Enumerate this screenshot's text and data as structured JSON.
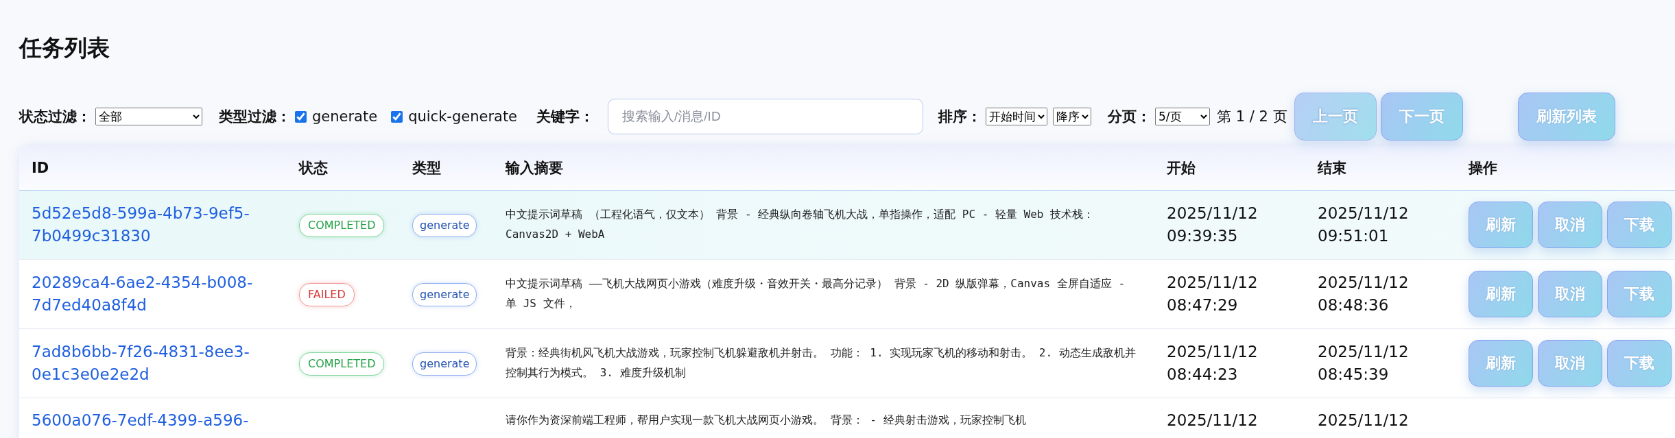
{
  "title": "任务列表",
  "filters": {
    "status_label": "状态过滤：",
    "status_value": "全部",
    "type_label": "类型过滤：",
    "types": [
      {
        "label": "generate",
        "checked": true
      },
      {
        "label": "quick-generate",
        "checked": true
      }
    ],
    "keyword_label": "关键字：",
    "keyword_placeholder": "搜索输入/消息/ID",
    "sort_label": "排序：",
    "sort_field": "开始时间",
    "sort_order": "降序",
    "page_label": "分页：",
    "page_size": "5/页",
    "page_info": "第 1 / 2 页",
    "buttons": [
      {
        "label": "上一页",
        "disabled": true
      },
      {
        "label": "下一页",
        "disabled": false
      },
      {
        "label": "刷新列表",
        "disabled": false
      }
    ]
  },
  "table": {
    "columns": [
      "ID",
      "状态",
      "类型",
      "输入摘要",
      "开始",
      "结束",
      "操作"
    ],
    "rows": [
      {
        "id": "5d52e5d8-599a-4b73-9ef5-7b0499c31830",
        "selected": true,
        "status": {
          "label": "COMPLETED",
          "kind": "completed"
        },
        "type": "generate",
        "summary": "中文提示词草稿 （工程化语气，仅文本） 背景 - 经典纵向卷轴飞机大战，单指操作，适配 PC - 轻量 Web 技术栈：Canvas2D + WebA",
        "start": "2025/11/12 09:39:35",
        "end": "2025/11/12 09:51:01",
        "actions": [
          "刷新",
          "取消",
          "下载"
        ]
      },
      {
        "id": "20289ca4-6ae2-4354-b008-7d7ed40a8f4d",
        "selected": false,
        "status": {
          "label": "FAILED",
          "kind": "failed"
        },
        "type": "generate",
        "summary": "中文提示词草稿 ——飞机大战网页小游戏（难度升级・音效开关・最高分记录） 背景 - 2D 纵版弹幕，Canvas 全屏自适应 - 单 JS 文件，",
        "start": "2025/11/12 08:47:29",
        "end": "2025/11/12 08:48:36",
        "actions": [
          "刷新",
          "取消",
          "下载"
        ]
      },
      {
        "id": "7ad8b6bb-7f26-4831-8ee3-0e1c3e0e2e2d",
        "selected": false,
        "status": {
          "label": "COMPLETED",
          "kind": "completed"
        },
        "type": "generate",
        "summary": "背景：经典街机风飞机大战游戏，玩家控制飞机躲避敌机并射击。 功能： 1. 实现玩家飞机的移动和射击。 2. 动态生成敌机并控制其行为模式。 3. 难度升级机制",
        "start": "2025/11/12 08:44:23",
        "end": "2025/11/12 08:45:39",
        "actions": [
          "刷新",
          "取消",
          "下载"
        ]
      },
      {
        "id": "5600a076-7edf-4399-a596-",
        "selected": false,
        "summary": "请你作为资深前端工程师，帮用户实现一款飞机大战网页小游戏。 背景： - 经典射击游戏，玩家控制飞机",
        "start": "2025/11/12",
        "end": "2025/11/12"
      }
    ]
  }
}
